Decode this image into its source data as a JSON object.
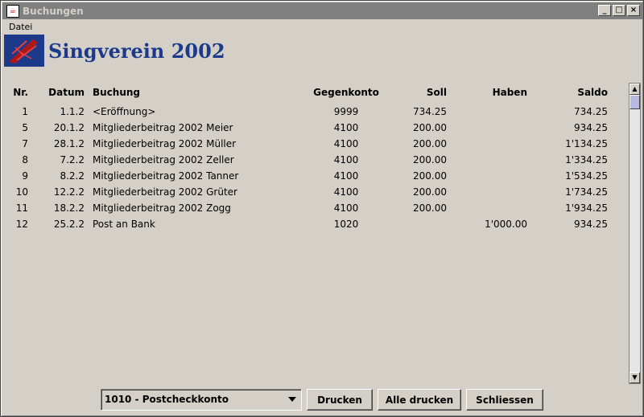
{
  "window": {
    "title": "Buchungen"
  },
  "menu": {
    "items": [
      "Datei"
    ]
  },
  "header": {
    "title": "Singverein 2002"
  },
  "table": {
    "columns": {
      "nr": "Nr.",
      "datum": "Datum",
      "buchung": "Buchung",
      "gegenkonto": "Gegenkonto",
      "soll": "Soll",
      "haben": "Haben",
      "saldo": "Saldo"
    },
    "rows": [
      {
        "nr": "1",
        "datum": "1.1.2",
        "buchung": "<Eröffnung>",
        "gegenkonto": "9999",
        "soll": "734.25",
        "haben": "",
        "saldo": "734.25"
      },
      {
        "nr": "5",
        "datum": "20.1.2",
        "buchung": "Mitgliederbeitrag 2002 Meier",
        "gegenkonto": "4100",
        "soll": "200.00",
        "haben": "",
        "saldo": "934.25"
      },
      {
        "nr": "7",
        "datum": "28.1.2",
        "buchung": "Mitgliederbeitrag 2002 Müller",
        "gegenkonto": "4100",
        "soll": "200.00",
        "haben": "",
        "saldo": "1'134.25"
      },
      {
        "nr": "8",
        "datum": "7.2.2",
        "buchung": "Mitgliederbeitrag 2002 Zeller",
        "gegenkonto": "4100",
        "soll": "200.00",
        "haben": "",
        "saldo": "1'334.25"
      },
      {
        "nr": "9",
        "datum": "8.2.2",
        "buchung": "Mitgliederbeitrag 2002 Tanner",
        "gegenkonto": "4100",
        "soll": "200.00",
        "haben": "",
        "saldo": "1'534.25"
      },
      {
        "nr": "10",
        "datum": "12.2.2",
        "buchung": "Mitgliederbeitrag 2002 Grüter",
        "gegenkonto": "4100",
        "soll": "200.00",
        "haben": "",
        "saldo": "1'734.25"
      },
      {
        "nr": "11",
        "datum": "18.2.2",
        "buchung": "Mitgliederbeitrag 2002 Zogg",
        "gegenkonto": "4100",
        "soll": "200.00",
        "haben": "",
        "saldo": "1'934.25"
      },
      {
        "nr": "12",
        "datum": "25.2.2",
        "buchung": "Post an Bank",
        "gegenkonto": "1020",
        "soll": "",
        "haben": "1'000.00",
        "saldo": "934.25"
      }
    ]
  },
  "footer": {
    "account_select": "1010 - Postcheckkonto",
    "print_label": "Drucken",
    "print_all_label": "Alle drucken",
    "close_label": "Schliessen"
  },
  "icons": {
    "app": "java-cup-icon",
    "minimize": "minimize-icon",
    "maximize": "maximize-icon",
    "close": "close-icon",
    "logo": "singverein-logo"
  },
  "colors": {
    "accent": "#1d3a8a",
    "titlebar": "#808080",
    "background": "#d4d0c8"
  }
}
